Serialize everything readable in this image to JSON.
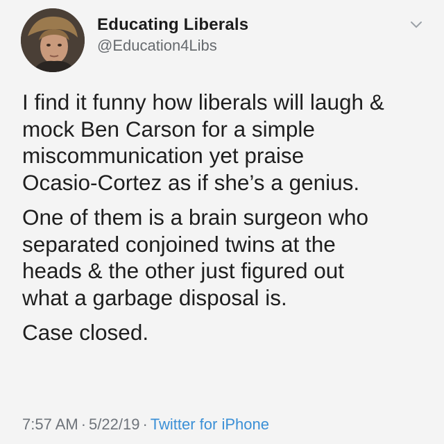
{
  "tweet": {
    "author": {
      "display_name": "Educating Liberals",
      "handle": "@Education4Libs",
      "avatar_icon": "profile-photo"
    },
    "menu_icon": "chevron-down-icon",
    "paragraphs": [
      "I find it funny how liberals will laugh &\nmock Ben Carson for a simple\nmiscommunication yet praise\nOcasio-Cortez as if she’s a genius.",
      "One of them is a brain surgeon who\nseparated conjoined twins at the\nheads & the other just figured out\nwhat a garbage disposal is.",
      "Case closed."
    ],
    "meta": {
      "time": "7:57 AM",
      "separator": "·",
      "date": "5/22/19",
      "source": "Twitter for iPhone"
    }
  },
  "colors": {
    "background": "#f4f4f4",
    "text": "#1e1e1e",
    "secondary_text": "#6e737a",
    "link": "#3a8fd6"
  }
}
